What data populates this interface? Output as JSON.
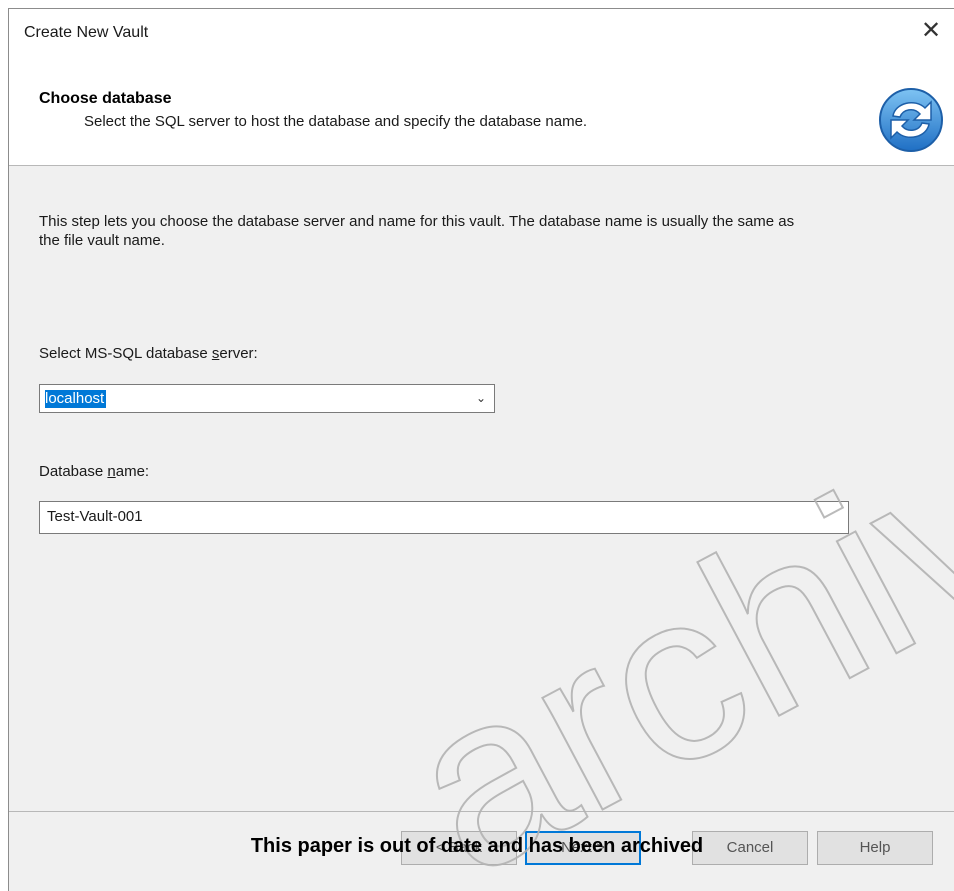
{
  "window": {
    "title": "Create New Vault",
    "close_icon": "close-icon"
  },
  "header": {
    "title": "Choose database",
    "subtitle": "Select the SQL server to host the database and specify the database name.",
    "icon": "refresh-arrows-icon"
  },
  "body": {
    "description": "This step lets you choose the database server and name for this vault. The database name is usually the same as the file vault name.",
    "server_label_pre": "Select MS-SQL database ",
    "server_label_mnemonic": "s",
    "server_label_post": "erver:",
    "server_value": "localhost",
    "dbname_label_pre": "Database ",
    "dbname_label_mnemonic": "n",
    "dbname_label_post": "ame:",
    "dbname_value": "Test-Vault-001"
  },
  "buttons": {
    "back": "< Back",
    "next": "Next >",
    "cancel": "Cancel",
    "help": "Help"
  },
  "overlay": {
    "archived_notice": "This paper is out of date and has been archived",
    "watermark": "archived",
    "watermark_color": "#b3b3b3"
  },
  "colors": {
    "selection": "#0078d7",
    "dialog_bg": "#f0f0f0"
  }
}
